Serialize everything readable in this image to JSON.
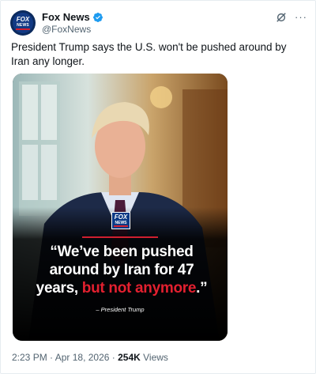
{
  "post": {
    "display_name": "Fox News",
    "handle": "@FoxNews",
    "verified": true,
    "avatar_logo": {
      "top": "FOX",
      "bottom": "NEWS"
    },
    "text": "President Trump says the U.S. won't be pushed around by Iran any longer.",
    "icons": {
      "grok": "grok-icon",
      "more": "more-icon",
      "verified": "verified-badge-icon"
    }
  },
  "media": {
    "logo": {
      "top": "FOX",
      "bottom": "NEWS",
      "tag": "CHANNEL"
    },
    "quote_part1": "“We’ve been pushed around by Iran for 47 years, ",
    "quote_highlight": "but not anymore",
    "quote_end": ".”",
    "attribution": "– President Trump"
  },
  "meta": {
    "time": "2:23 PM",
    "separator": " · ",
    "date": "Apr 18, 2026",
    "views_count": "254K",
    "views_label": " Views"
  },
  "colors": {
    "accent_blue": "#1d9bf0",
    "fox_red": "#e3202f",
    "fox_blue": "#0b3a86",
    "muted": "#536471"
  }
}
